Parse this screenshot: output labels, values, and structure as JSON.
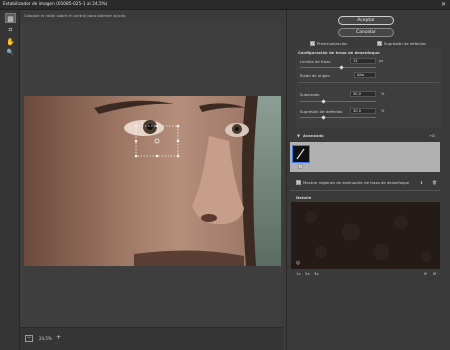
{
  "window": {
    "title": "Estabilizador de imagen (01085-025-1 al 24,5%)",
    "close_glyph": "✕"
  },
  "tools": [
    {
      "name": "blur-estimation-tool-icon",
      "glyph": "▦",
      "active": true
    },
    {
      "name": "blur-direction-tool-icon",
      "glyph": "⌗",
      "active": false
    },
    {
      "name": "hand-tool-icon",
      "glyph": "✋",
      "active": false
    },
    {
      "name": "zoom-tool-icon",
      "glyph": "🔍",
      "active": false
    }
  ],
  "hint": "Coloque el ratón sobre el control para obtener ayuda.",
  "footer": {
    "zoom_value": "24,5%",
    "zoom_out_glyph": "−",
    "zoom_in_glyph": "+"
  },
  "actions": {
    "ok_label": "Aceptar",
    "cancel_label": "Cancelar"
  },
  "options": {
    "preview_label": "Previsualización",
    "preview_checked": true,
    "artifact_suppression_label": "Supresión de defectos",
    "artifact_suppression_checked": true
  },
  "trace_config": {
    "title": "Configuración de trazo de desenfoque",
    "trace_limits_label": "Límites de trazo",
    "trace_limits_value": "15",
    "trace_limits_unit": "px",
    "source_noise_label": "Ruido de origen",
    "source_noise_value": "Alto",
    "smoothing_label": "Suavizado",
    "smoothing_value": "30,0",
    "smoothing_unit": "%",
    "artifact_suppression_label": "Supresión de defectos",
    "artifact_suppression_value": "30,0",
    "artifact_suppression_unit": "%"
  },
  "advanced": {
    "title": "Avanzado",
    "add_glyph": "+⊡",
    "show_regions_label": "Mostrar regiones de estimación de trazo de desenfoque",
    "show_regions_checked": true
  },
  "detail": {
    "title": "Detalle"
  },
  "colors": {
    "background": "#3b3b3b",
    "panel": "#3a3a3a",
    "advanced_area": "#b1b1b1",
    "accent": "#3d7cf0"
  }
}
